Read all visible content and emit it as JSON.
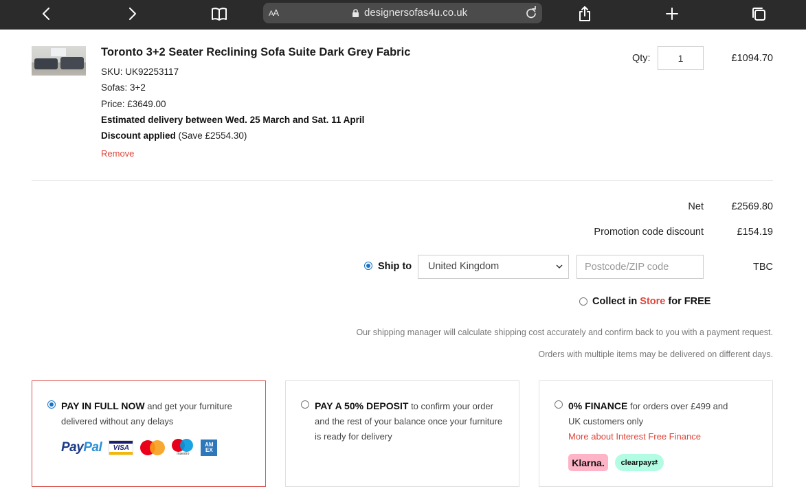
{
  "browser": {
    "reader_label_big": "A",
    "reader_label_small": "A",
    "url": "designersofas4u.co.uk"
  },
  "product": {
    "title": "Toronto 3+2 Seater Reclining Sofa Suite Dark Grey Fabric",
    "sku": "SKU: UK92253117",
    "sofas": "Sofas: 3+2",
    "price": "Price: £3649.00",
    "delivery": "Estimated delivery between Wed. 25 March and Sat. 11 April",
    "discount_label": "Discount applied",
    "discount_save": "(Save £2554.30)",
    "remove_label": "Remove",
    "qty_label": "Qty:",
    "qty_value": "1",
    "line_price": "£1094.70"
  },
  "summary": {
    "net_label": "Net",
    "net_value": "£2569.80",
    "promo_label": "Promotion code discount",
    "promo_value": "£154.19",
    "ship_to_label": "Ship to",
    "country": "United Kingdom",
    "postcode_placeholder": "Postcode/ZIP code",
    "shipping_value": "TBC",
    "collect_prefix": "Collect in",
    "collect_store": "Store",
    "collect_suffix": "for FREE",
    "note_1": "Our shipping manager will calculate shipping cost accurately and confirm back to you with a payment request.",
    "note_2": "Orders with multiple items may be delivered on different days."
  },
  "payment": {
    "full": {
      "lead": "PAY IN FULL NOW",
      "text": "and get your furniture delivered without any delays"
    },
    "deposit": {
      "lead": "PAY A 50% DEPOSIT",
      "text": "to confirm your order and the rest of your balance once your furniture is ready for delivery"
    },
    "finance": {
      "lead": "0% FINANCE",
      "text": "for orders over £499 and UK customers only",
      "link": "More about Interest Free Finance"
    },
    "logos": {
      "paypal_pay": "Pay",
      "paypal_pal": "Pal",
      "visa": "VISA",
      "maestro": "maestro",
      "amex": "AM EX",
      "klarna": "Klarna.",
      "clearpay": "clearpay⇄"
    }
  },
  "colors": {
    "accent_red": "#e0443a",
    "radio_blue": "#1a73c9",
    "browser_bar": "#2b2b2b"
  }
}
